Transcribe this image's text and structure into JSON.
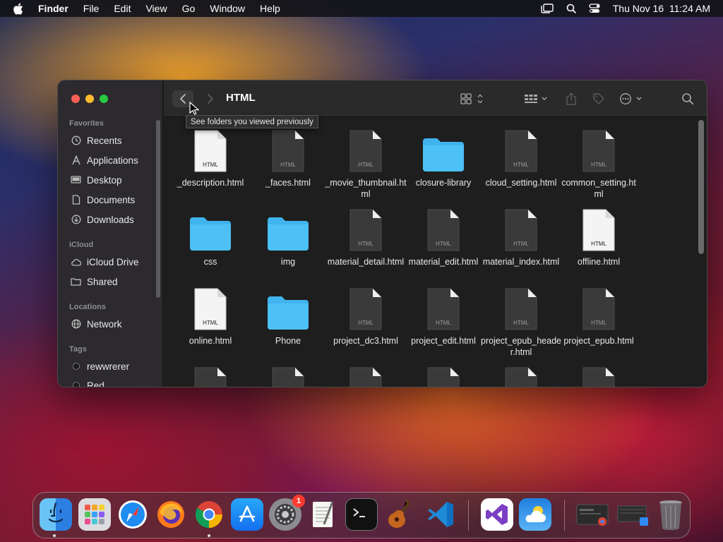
{
  "menubar": {
    "app_name": "Finder",
    "items": [
      "File",
      "Edit",
      "View",
      "Go",
      "Window",
      "Help"
    ],
    "clock": "Thu Nov 16  11:24 AM"
  },
  "window": {
    "title": "HTML",
    "tooltip": "See folders you viewed previously"
  },
  "sidebar": {
    "sections": {
      "favorites": "Favorites",
      "icloud": "iCloud",
      "locations": "Locations",
      "tags": "Tags"
    },
    "favorites": [
      "Recents",
      "Applications",
      "Desktop",
      "Documents",
      "Downloads"
    ],
    "icloud": [
      "iCloud Drive",
      "Shared"
    ],
    "locations": [
      "Network"
    ],
    "tags": [
      "rewwrerer",
      "Red"
    ]
  },
  "files": [
    {
      "name": "_description.html",
      "kind": "html-white"
    },
    {
      "name": "_faces.html",
      "kind": "html-dark"
    },
    {
      "name": "_movie_thumbnail.html",
      "kind": "html-dark"
    },
    {
      "name": "closure-library",
      "kind": "folder"
    },
    {
      "name": "cloud_setting.html",
      "kind": "html-dark"
    },
    {
      "name": "common_setting.html",
      "kind": "html-dark"
    },
    {
      "name": "css",
      "kind": "folder"
    },
    {
      "name": "img",
      "kind": "folder"
    },
    {
      "name": "material_detail.html",
      "kind": "html-dark"
    },
    {
      "name": "material_edit.html",
      "kind": "html-dark"
    },
    {
      "name": "material_index.html",
      "kind": "html-dark"
    },
    {
      "name": "offline.html",
      "kind": "html-white"
    },
    {
      "name": "online.html",
      "kind": "html-white"
    },
    {
      "name": "Phone",
      "kind": "folder"
    },
    {
      "name": "project_dc3.html",
      "kind": "html-dark"
    },
    {
      "name": "project_edit.html",
      "kind": "html-dark"
    },
    {
      "name": "project_epub_header.html",
      "kind": "html-dark"
    },
    {
      "name": "project_epub.html",
      "kind": "html-dark"
    }
  ],
  "icon_label_html": "HTML",
  "dock": {
    "apps": [
      "finder-icon",
      "launchpad-icon",
      "safari-icon",
      "firefox-icon",
      "chrome-icon",
      "app-store-icon",
      "system-settings-icon",
      "textedit-icon",
      "terminal-icon",
      "garageband-icon",
      "vscode-icon",
      "visual-studio-icon",
      "weather-icon"
    ],
    "settings_badge": "1"
  },
  "colors": {
    "folder": "#3fb4ee",
    "accent_red": "#fe5f57",
    "accent_yellow": "#febc2e",
    "accent_green": "#28c840"
  }
}
